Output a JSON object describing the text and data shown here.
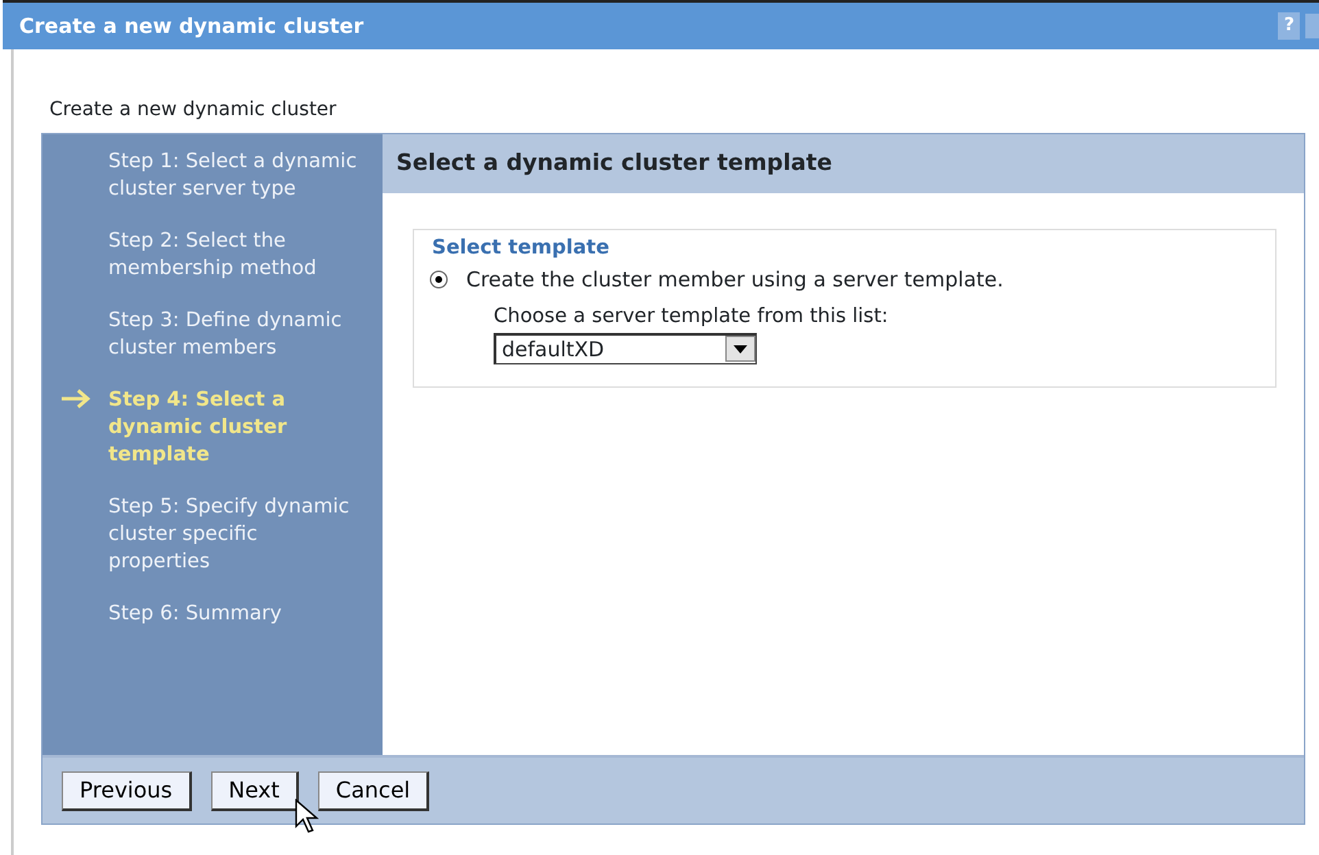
{
  "window": {
    "title": "Create a new dynamic cluster",
    "help": "?"
  },
  "subtitle": "Create a new dynamic cluster",
  "steps": [
    {
      "label": "Step 1: Select a dynamic cluster server type",
      "selected": false
    },
    {
      "label": "Step 2: Select the membership method",
      "selected": false
    },
    {
      "label": "Step 3: Define dynamic cluster members",
      "selected": false
    },
    {
      "label": "Step 4: Select a dynamic cluster template",
      "selected": true
    },
    {
      "label": "Step 5: Specify dynamic cluster specific properties",
      "selected": false
    },
    {
      "label": "Step 6: Summary",
      "selected": false
    }
  ],
  "panel": {
    "title": "Select a dynamic cluster template",
    "legend": "Select template",
    "option": {
      "label": "Create the cluster member using a server template.",
      "checked": true
    },
    "select_label": "Choose a server template from this list:",
    "select_value": "defaultXD"
  },
  "buttons": [
    "Previous",
    "Next",
    "Cancel"
  ]
}
